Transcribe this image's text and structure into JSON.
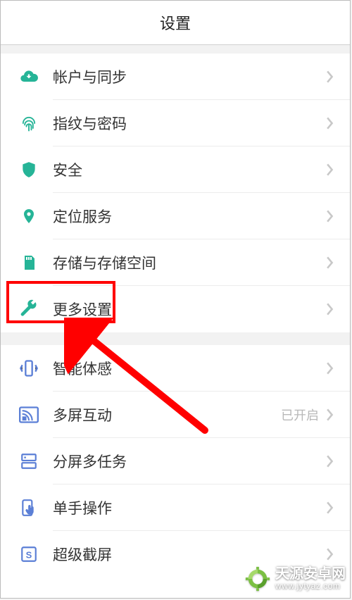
{
  "header": {
    "title": "设置"
  },
  "accent": "#26b497",
  "accent_blue": "#5b7fd6",
  "items_group1": [
    {
      "id": "account-sync",
      "label": "帐户与同步",
      "icon": "cloud-sync-icon",
      "color": "#26b497"
    },
    {
      "id": "fingerprint",
      "label": "指纹与密码",
      "icon": "fingerprint-icon",
      "color": "#26b497"
    },
    {
      "id": "security",
      "label": "安全",
      "icon": "shield-icon",
      "color": "#26b497"
    },
    {
      "id": "location",
      "label": "定位服务",
      "icon": "location-icon",
      "color": "#26b497"
    },
    {
      "id": "storage",
      "label": "存储与存储空间",
      "icon": "sd-card-icon",
      "color": "#26b497"
    },
    {
      "id": "more-settings",
      "label": "更多设置",
      "icon": "wrench-icon",
      "color": "#26b497"
    }
  ],
  "items_group2": [
    {
      "id": "smart-motion",
      "label": "智能体感",
      "icon": "phone-shake-icon",
      "color": "#5b7fd6"
    },
    {
      "id": "multi-screen",
      "label": "多屏互动",
      "icon": "cast-icon",
      "color": "#5b7fd6",
      "trailing": "已开启"
    },
    {
      "id": "split-screen",
      "label": "分屏多任务",
      "icon": "split-icon",
      "color": "#5b7fd6"
    },
    {
      "id": "one-hand",
      "label": "单手操作",
      "icon": "touch-icon",
      "color": "#5b7fd6"
    },
    {
      "id": "super-shot",
      "label": "超级截屏",
      "icon": "screenshot-s-icon",
      "color": "#5b7fd6"
    }
  ],
  "watermark": {
    "line1": "天源安卓网",
    "line2": "www.jytyaz.com"
  }
}
